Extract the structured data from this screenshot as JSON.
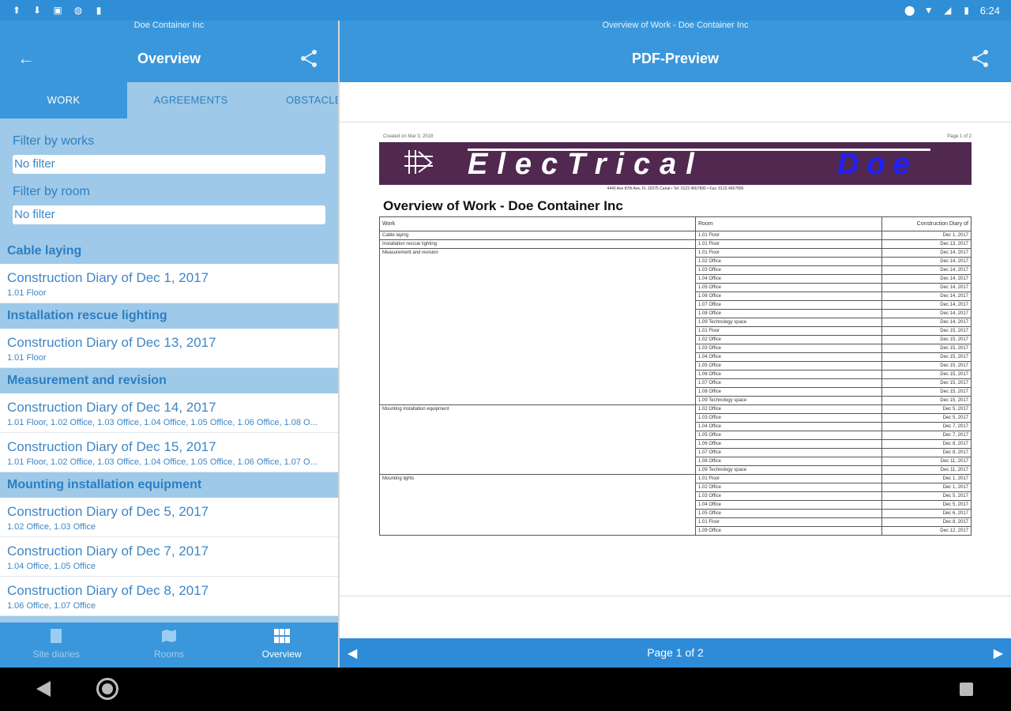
{
  "status_bar": {
    "time": "6:24",
    "left_icons": [
      "upload-icon",
      "download-icon",
      "photo-icon",
      "circle-icon",
      "sd-card-icon"
    ],
    "right_icons": [
      "location-icon",
      "wifi-icon",
      "signal-icon",
      "battery-icon"
    ]
  },
  "left": {
    "subtitle": "Doe Container Inc",
    "title": "Overview",
    "tabs": [
      {
        "label": "WORK",
        "active": true
      },
      {
        "label": "AGREEMENTS",
        "active": false
      },
      {
        "label": "OBSTACLE",
        "active": false
      }
    ],
    "filters": {
      "works_label": "Filter by works",
      "works_value": "No filter",
      "room_label": "Filter by room",
      "room_value": "No filter"
    },
    "groups": [
      {
        "name": "Cable laying",
        "items": [
          {
            "title": "Construction Diary of Dec 1, 2017",
            "sub": "1.01 Floor"
          }
        ]
      },
      {
        "name": "Installation rescue lighting",
        "items": [
          {
            "title": "Construction Diary of Dec 13, 2017",
            "sub": "1.01 Floor"
          }
        ]
      },
      {
        "name": "Measurement and revision",
        "items": [
          {
            "title": "Construction Diary of Dec 14, 2017",
            "sub": "1.01 Floor, 1.02 Office, 1.03 Office, 1.04 Office, 1.05 Office, 1.06 Office, 1.08 O..."
          },
          {
            "title": "Construction Diary of Dec 15, 2017",
            "sub": "1.01 Floor, 1.02 Office, 1.03 Office, 1.04 Office, 1.05 Office, 1.06 Office, 1.07 O..."
          }
        ]
      },
      {
        "name": "Mounting installation equipment",
        "items": [
          {
            "title": "Construction Diary of Dec 5, 2017",
            "sub": "1.02 Office, 1.03 Office"
          },
          {
            "title": "Construction Diary of Dec 7, 2017",
            "sub": "1.04 Office, 1.05 Office"
          },
          {
            "title": "Construction Diary of Dec 8, 2017",
            "sub": "1.06 Office, 1.07 Office"
          }
        ]
      }
    ],
    "bottom_nav": [
      {
        "label": "Site diaries",
        "icon": "book-icon",
        "active": false
      },
      {
        "label": "Rooms",
        "icon": "map-icon",
        "active": false
      },
      {
        "label": "Overview",
        "icon": "grid-icon",
        "active": true
      }
    ]
  },
  "right": {
    "subtitle": "Overview of Work - Doe Container Inc",
    "title": "PDF-Preview",
    "pager": "Page 1 of 2",
    "pdf": {
      "created": "Created on Mar 3, 2018",
      "page_of": "Page 1 of 2",
      "banner_text": "ElecTrical",
      "banner_doe": "Doe",
      "address": "4440 Ave 87th Ave, FL 32075 Canal • Tel: 0123 4567890 • Fax: 0123 4567890",
      "title": "Overview of Work - Doe Container Inc",
      "headers": [
        "Work",
        "Room",
        "Construction Diary of"
      ],
      "rows": [
        {
          "work": "Cable laying",
          "span": 1,
          "room": "1.01 Floor",
          "date": "Dec 1, 2017"
        },
        {
          "work": "Installation rescue lighting",
          "span": 1,
          "room": "1.01 Floor",
          "date": "Dec 13, 2017"
        },
        {
          "work": "Measurement and revision",
          "span": 18,
          "room": "1.01 Floor",
          "date": "Dec 14, 2017"
        },
        {
          "work": "",
          "span": 0,
          "room": "1.02 Office",
          "date": "Dec 14, 2017"
        },
        {
          "work": "",
          "span": 0,
          "room": "1.03 Office",
          "date": "Dec 14, 2017"
        },
        {
          "work": "",
          "span": 0,
          "room": "1.04 Office",
          "date": "Dec 14, 2017"
        },
        {
          "work": "",
          "span": 0,
          "room": "1.05 Office",
          "date": "Dec 14, 2017"
        },
        {
          "work": "",
          "span": 0,
          "room": "1.06 Office",
          "date": "Dec 14, 2017"
        },
        {
          "work": "",
          "span": 0,
          "room": "1.07 Office",
          "date": "Dec 14, 2017"
        },
        {
          "work": "",
          "span": 0,
          "room": "1.08 Office",
          "date": "Dec 14, 2017"
        },
        {
          "work": "",
          "span": 0,
          "room": "1.09 Technology space",
          "date": "Dec 14, 2017"
        },
        {
          "work": "",
          "span": 0,
          "room": "1.01 Floor",
          "date": "Dec 15, 2017"
        },
        {
          "work": "",
          "span": 0,
          "room": "1.02 Office",
          "date": "Dec 15, 2017"
        },
        {
          "work": "",
          "span": 0,
          "room": "1.03 Office",
          "date": "Dec 15, 2017"
        },
        {
          "work": "",
          "span": 0,
          "room": "1.04 Office",
          "date": "Dec 15, 2017"
        },
        {
          "work": "",
          "span": 0,
          "room": "1.05 Office",
          "date": "Dec 15, 2017"
        },
        {
          "work": "",
          "span": 0,
          "room": "1.06 Office",
          "date": "Dec 15, 2017"
        },
        {
          "work": "",
          "span": 0,
          "room": "1.07 Office",
          "date": "Dec 15, 2017"
        },
        {
          "work": "",
          "span": 0,
          "room": "1.08 Office",
          "date": "Dec 15, 2017"
        },
        {
          "work": "",
          "span": 0,
          "room": "1.09 Technology space",
          "date": "Dec 15, 2017"
        },
        {
          "work": "Mounting installation equipment",
          "span": 8,
          "room": "1.02 Office",
          "date": "Dec 5, 2017"
        },
        {
          "work": "",
          "span": 0,
          "room": "1.03 Office",
          "date": "Dec 5, 2017"
        },
        {
          "work": "",
          "span": 0,
          "room": "1.04 Office",
          "date": "Dec 7, 2017"
        },
        {
          "work": "",
          "span": 0,
          "room": "1.05 Office",
          "date": "Dec 7, 2017"
        },
        {
          "work": "",
          "span": 0,
          "room": "1.06 Office",
          "date": "Dec 8, 2017"
        },
        {
          "work": "",
          "span": 0,
          "room": "1.07 Office",
          "date": "Dec 8, 2017"
        },
        {
          "work": "",
          "span": 0,
          "room": "1.08 Office",
          "date": "Dec 11, 2017"
        },
        {
          "work": "",
          "span": 0,
          "room": "1.09 Technology space",
          "date": "Dec 11, 2017"
        },
        {
          "work": "Mounting lights",
          "span": 7,
          "room": "1.01 Floor",
          "date": "Dec 1, 2017"
        },
        {
          "work": "",
          "span": 0,
          "room": "1.02 Office",
          "date": "Dec 1, 2017"
        },
        {
          "work": "",
          "span": 0,
          "room": "1.03 Office",
          "date": "Dec 5, 2017"
        },
        {
          "work": "",
          "span": 0,
          "room": "1.04 Office",
          "date": "Dec 5, 2017"
        },
        {
          "work": "",
          "span": 0,
          "room": "1.05 Office",
          "date": "Dec 6, 2017"
        },
        {
          "work": "",
          "span": 0,
          "room": "1.01 Floor",
          "date": "Dec 8, 2017"
        },
        {
          "work": "",
          "span": 0,
          "room": "1.09 Office",
          "date": "Dec 12, 2017"
        }
      ]
    }
  }
}
